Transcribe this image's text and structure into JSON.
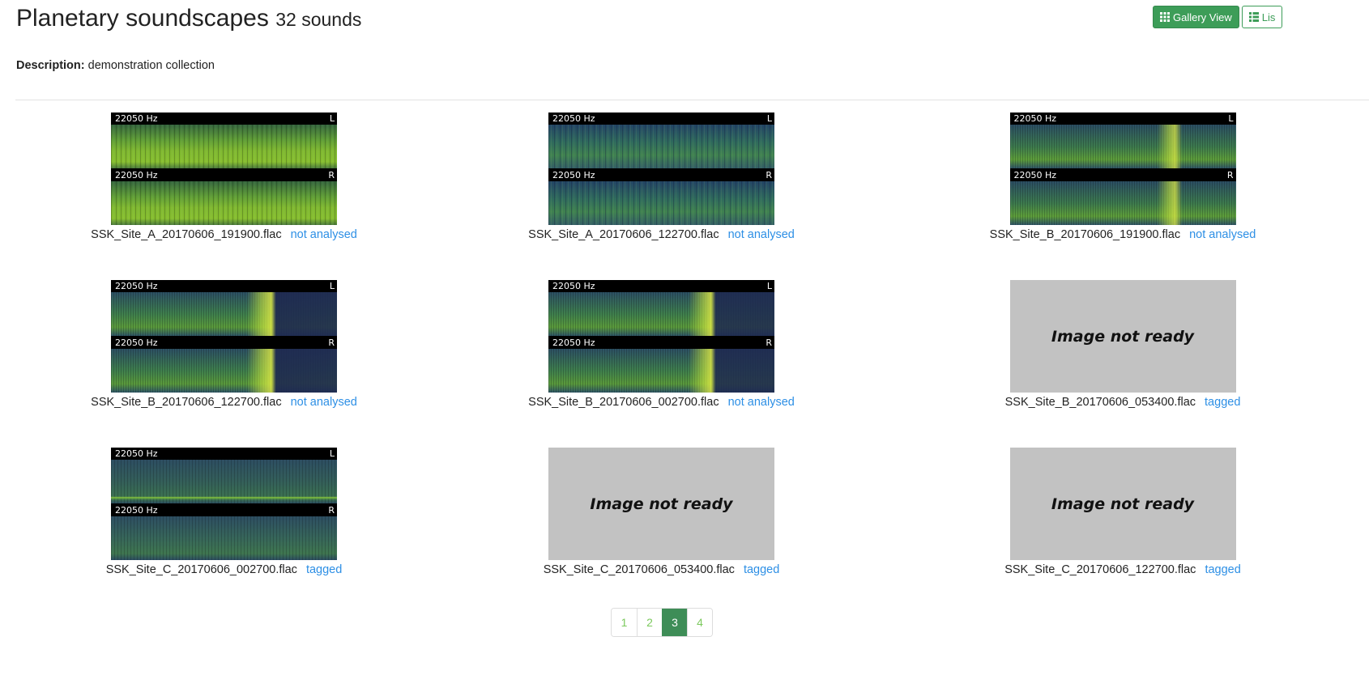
{
  "header": {
    "title": "Planetary soundscapes",
    "count": "32 sounds"
  },
  "view_toggle": {
    "gallery_label": "Gallery View",
    "list_label": "Lis",
    "active": "gallery",
    "gallery_icon": "grid-icon",
    "list_icon": "list-icon"
  },
  "description": {
    "label": "Description:",
    "text": "demonstration collection"
  },
  "colors": {
    "accent": "#3d9d58",
    "link": "#2d8fe5",
    "placeholder": "#c2c2c2",
    "page_link": "#7bc95d"
  },
  "recordings": [
    {
      "filename": "SSK_Site_A_20170606_191900.flac",
      "status": "not analysed",
      "image": "spectrogram",
      "freq_top": "22050 Hz",
      "chan_top": "L",
      "freq_bottom": "22050 Hz",
      "chan_bottom": "R"
    },
    {
      "filename": "SSK_Site_A_20170606_122700.flac",
      "status": "not analysed",
      "image": "spectrogram",
      "freq_top": "22050 Hz",
      "chan_top": "L",
      "freq_bottom": "22050 Hz",
      "chan_bottom": "R"
    },
    {
      "filename": "SSK_Site_B_20170606_191900.flac",
      "status": "not analysed",
      "image": "spectrogram",
      "freq_top": "22050 Hz",
      "chan_top": "L",
      "freq_bottom": "22050 Hz",
      "chan_bottom": "R"
    },
    {
      "filename": "SSK_Site_B_20170606_122700.flac",
      "status": "not analysed",
      "image": "spectrogram",
      "freq_top": "22050 Hz",
      "chan_top": "L",
      "freq_bottom": "22050 Hz",
      "chan_bottom": "R"
    },
    {
      "filename": "SSK_Site_B_20170606_002700.flac",
      "status": "not analysed",
      "image": "spectrogram",
      "freq_top": "22050 Hz",
      "chan_top": "L",
      "freq_bottom": "22050 Hz",
      "chan_bottom": "R"
    },
    {
      "filename": "SSK_Site_B_20170606_053400.flac",
      "status": "tagged",
      "image": "placeholder",
      "placeholder_text": "Image not ready"
    },
    {
      "filename": "SSK_Site_C_20170606_002700.flac",
      "status": "tagged",
      "image": "spectrogram",
      "freq_top": "22050 Hz",
      "chan_top": "L",
      "freq_bottom": "22050 Hz",
      "chan_bottom": "R"
    },
    {
      "filename": "SSK_Site_C_20170606_053400.flac",
      "status": "tagged",
      "image": "placeholder",
      "placeholder_text": "Image not ready"
    },
    {
      "filename": "SSK_Site_C_20170606_122700.flac",
      "status": "tagged",
      "image": "placeholder",
      "placeholder_text": "Image not ready"
    }
  ],
  "pagination": {
    "pages": [
      "1",
      "2",
      "3",
      "4"
    ],
    "current": "3"
  }
}
